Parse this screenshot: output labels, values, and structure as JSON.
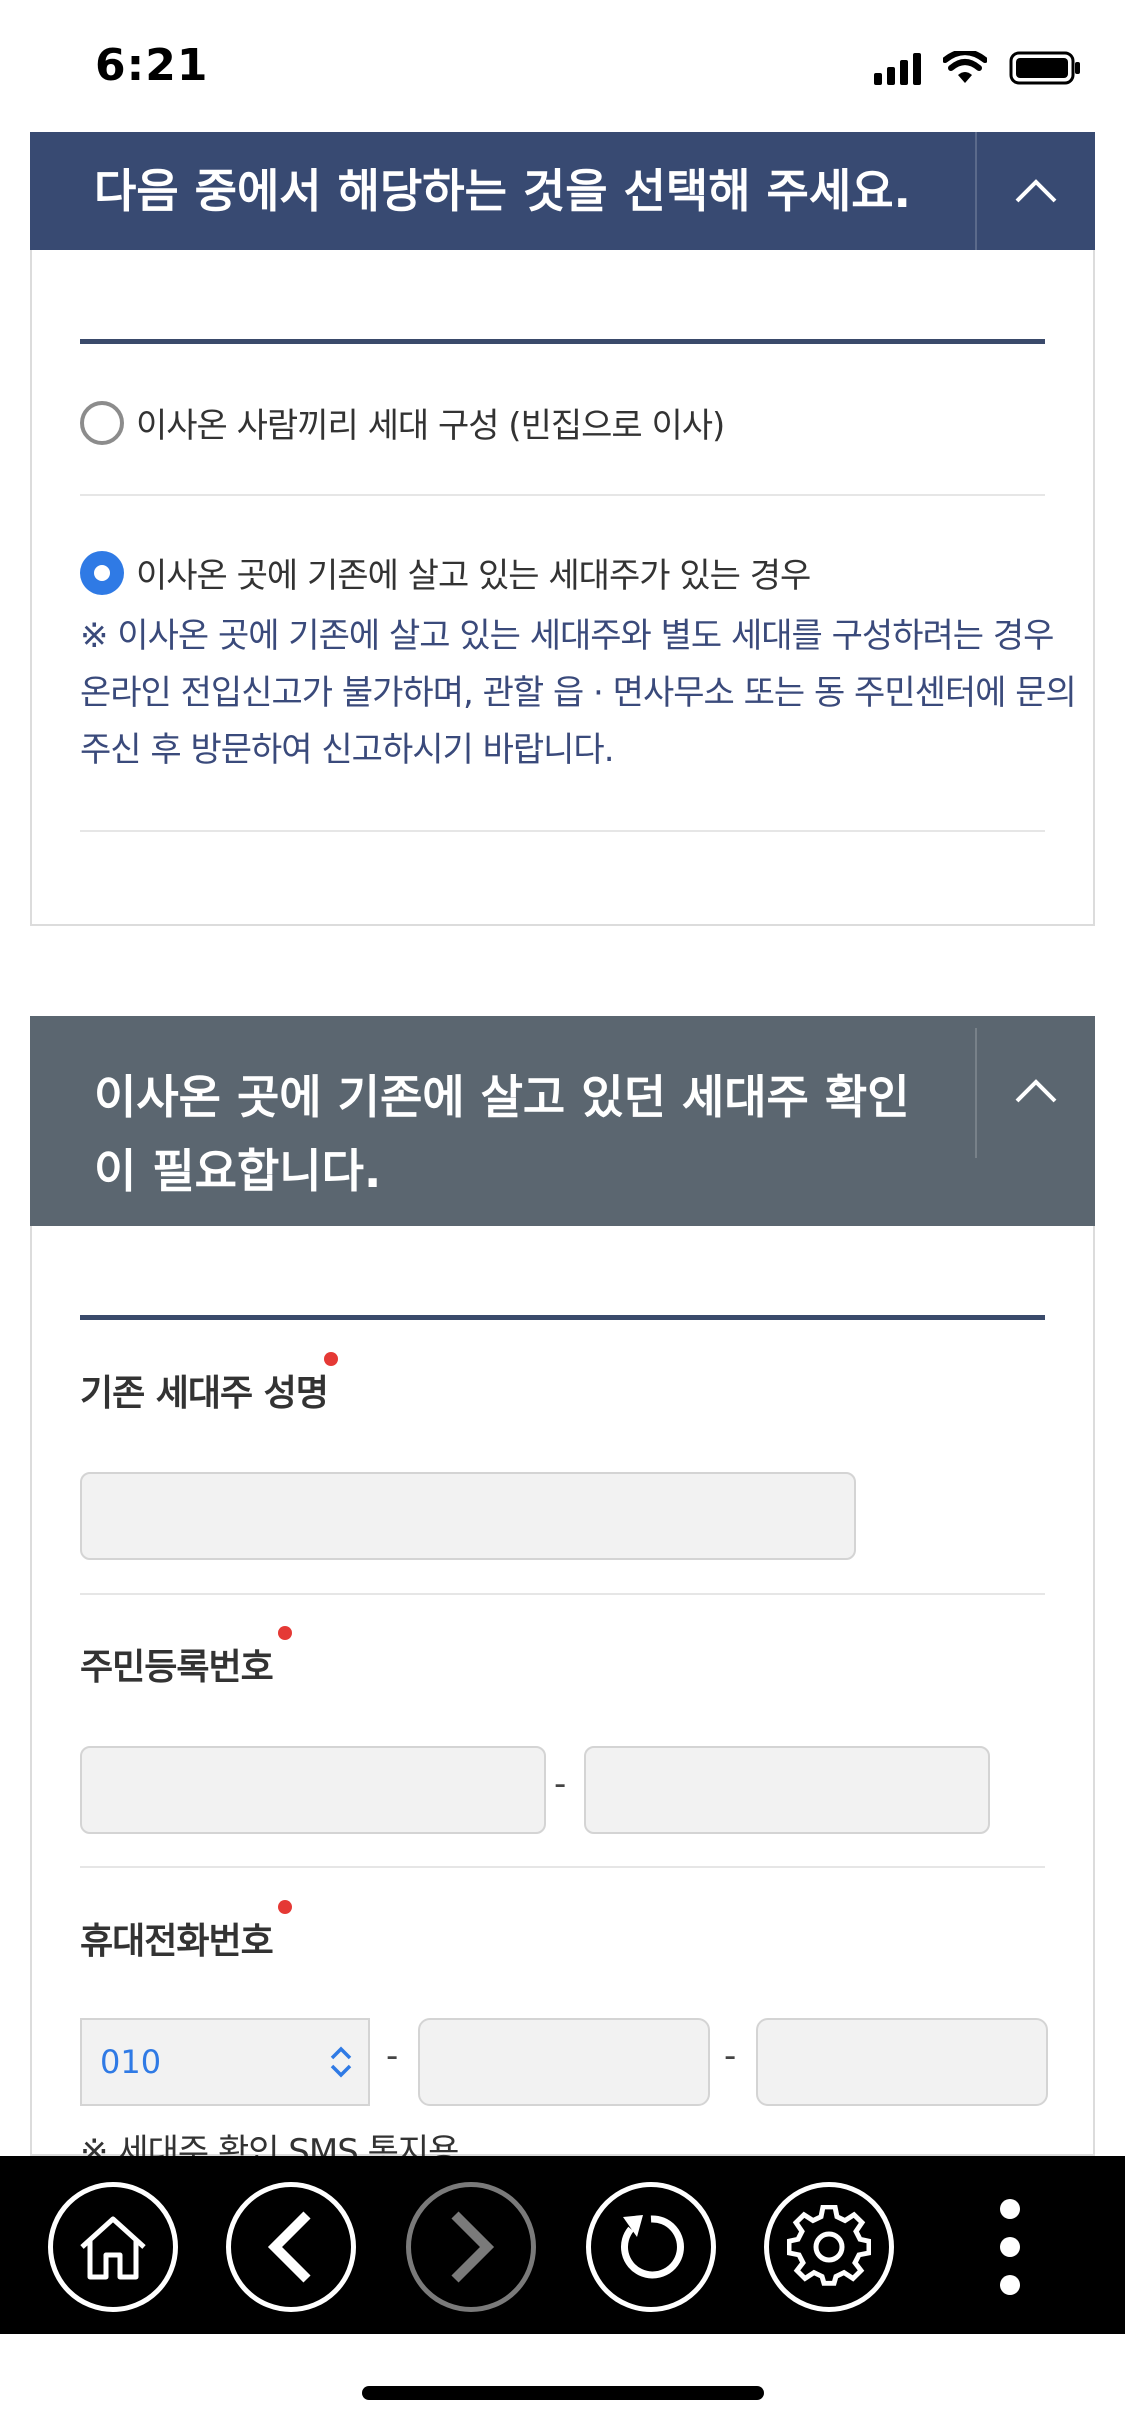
{
  "status_bar": {
    "time": "6:21"
  },
  "section1": {
    "title": "다음 중에서 해당하는 것을 선택해 주세요.",
    "header_color": "#384a72",
    "options": [
      {
        "label": "이사온 사람끼리 세대 구성 (빈집으로 이사)",
        "selected": false
      },
      {
        "label": "이사온 곳에 기존에 살고 있는 세대주가 있는 경우",
        "selected": true
      }
    ],
    "note": "※ 이사온 곳에 기존에 살고 있는 세대주와 별도 세대를 구성하려는 경우 온라인 전입신고가 불가하며, 관할 읍 · 면사무소 또는 동 주민센터에 문의주신 후 방문하여 신고하시기 바랍니다."
  },
  "section2": {
    "title_line1": "이사온 곳에 기존에 살고 있던 세대주 확인",
    "title_line2": "이 필요합니다.",
    "header_color": "#5b6670",
    "fields": {
      "name_label": "기존 세대주 성명",
      "rrn_label": "주민등록번호",
      "phone_label": "휴대전화번호",
      "phone_prefix": "010",
      "separator": "-"
    },
    "sms_note": "※ 세대주 확인 SMS 통지용"
  },
  "toolbar": {
    "buttons": [
      "home-icon",
      "back-icon",
      "forward-icon",
      "refresh-icon",
      "gear-icon",
      "more-icon"
    ],
    "forward_disabled": true
  },
  "colors": {
    "accent": "#2f7ae5",
    "required": "#e53935",
    "note_text": "#3a4a7b"
  }
}
